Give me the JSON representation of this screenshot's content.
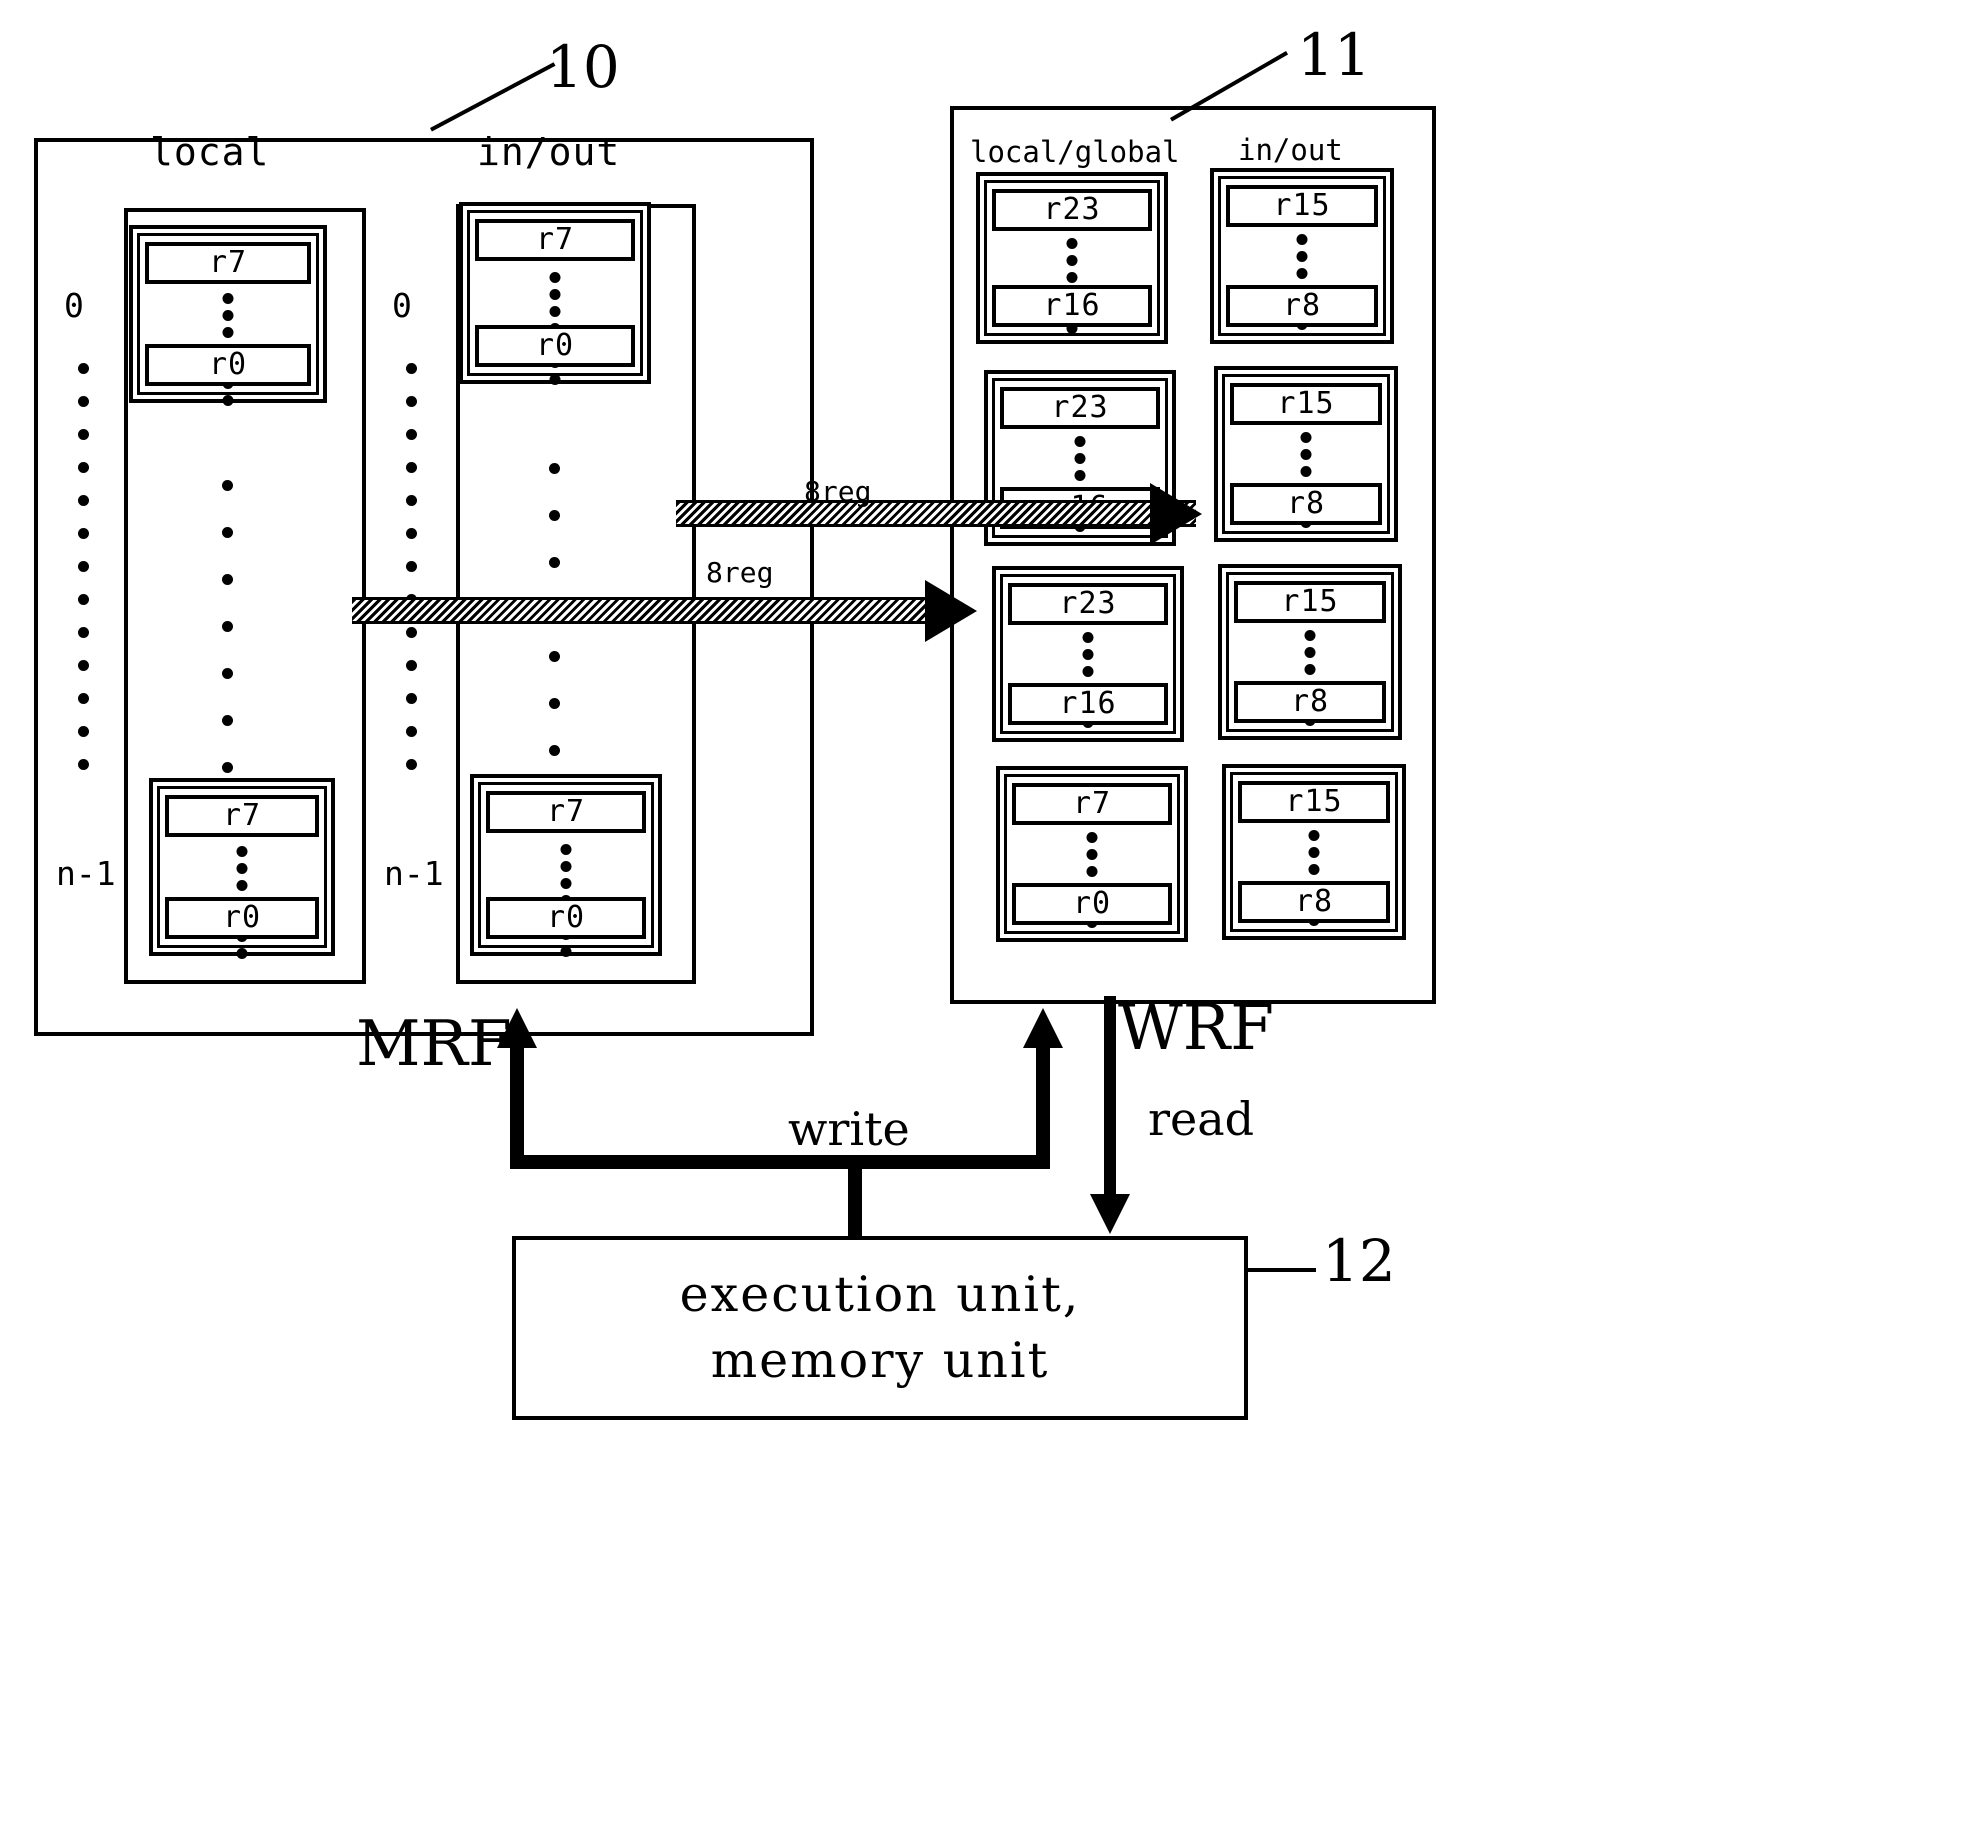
{
  "figure": {
    "ref_10": "10",
    "ref_11": "11",
    "ref_12": "12",
    "mrf_name": "MRF",
    "wrf_name": "WRF",
    "write_label": "write",
    "read_label": "read",
    "bus_label_upper": "8reg",
    "bus_label_lower": "8reg",
    "exec_line1": "execution unit,",
    "exec_line2": "memory unit"
  },
  "mrf": {
    "columns": [
      {
        "header": "local",
        "index_top": "0",
        "index_bottom": "n-1",
        "banks": [
          {
            "top": "r7",
            "bottom": "r0"
          },
          {
            "top": "r7",
            "bottom": "r0"
          }
        ]
      },
      {
        "header": "in/out",
        "index_top": "0",
        "index_bottom": "n-1",
        "banks": [
          {
            "top": "r7",
            "bottom": "r0"
          },
          {
            "top": "r7",
            "bottom": "r0"
          }
        ]
      }
    ]
  },
  "wrf": {
    "columns": [
      {
        "header": "local/global",
        "banks": [
          {
            "top": "r23",
            "bottom": "r16"
          },
          {
            "top": "r23",
            "bottom": "r16"
          },
          {
            "top": "r23",
            "bottom": "r16"
          },
          {
            "top": "r7",
            "bottom": "r0"
          }
        ]
      },
      {
        "header": "in/out",
        "banks": [
          {
            "top": "r15",
            "bottom": "r8"
          },
          {
            "top": "r15",
            "bottom": "r8"
          },
          {
            "top": "r15",
            "bottom": "r8"
          },
          {
            "top": "r15",
            "bottom": "r8"
          }
        ]
      }
    ]
  },
  "colors": {
    "ink": "#000000",
    "paper": "#ffffff"
  }
}
